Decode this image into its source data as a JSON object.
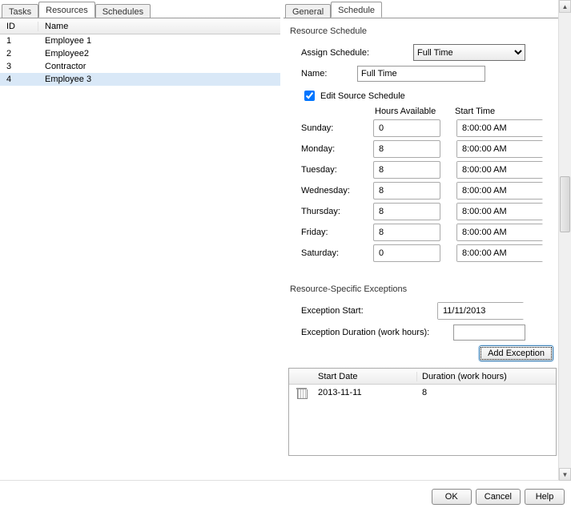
{
  "leftTabs": {
    "items": [
      "Tasks",
      "Resources",
      "Schedules"
    ],
    "active": 1
  },
  "grid": {
    "headers": {
      "id": "ID",
      "name": "Name"
    },
    "rows": [
      {
        "id": "1",
        "name": "Employee 1"
      },
      {
        "id": "2",
        "name": "Employee2"
      },
      {
        "id": "3",
        "name": "Contractor"
      },
      {
        "id": "4",
        "name": "Employee 3"
      }
    ],
    "selected": 3
  },
  "rightTabs": {
    "items": [
      "General",
      "Schedule"
    ],
    "active": 1
  },
  "schedule": {
    "groupLabel": "Resource Schedule",
    "assignLabel": "Assign Schedule:",
    "assignValue": "Full Time",
    "nameLabel": "Name:",
    "nameValue": "Full Time",
    "editSourceLabel": "Edit Source Schedule",
    "editSourceChecked": true,
    "hoursHeader": "Hours Available",
    "startHeader": "Start Time",
    "days": [
      {
        "label": "Sunday:",
        "hours": "0",
        "start": "8:00:00 AM"
      },
      {
        "label": "Monday:",
        "hours": "8",
        "start": "8:00:00 AM"
      },
      {
        "label": "Tuesday:",
        "hours": "8",
        "start": "8:00:00 AM"
      },
      {
        "label": "Wednesday:",
        "hours": "8",
        "start": "8:00:00 AM"
      },
      {
        "label": "Thursday:",
        "hours": "8",
        "start": "8:00:00 AM"
      },
      {
        "label": "Friday:",
        "hours": "8",
        "start": "8:00:00 AM"
      },
      {
        "label": "Saturday:",
        "hours": "0",
        "start": "8:00:00 AM"
      }
    ]
  },
  "exceptions": {
    "groupLabel": "Resource-Specific Exceptions",
    "startLabel": "Exception Start:",
    "startValue": "11/11/2013",
    "durationLabel": "Exception Duration (work hours):",
    "durationValue": "",
    "addButton": "Add Exception",
    "table": {
      "headers": {
        "start": "Start Date",
        "dur": "Duration (work hours)"
      },
      "rows": [
        {
          "start": "2013-11-11",
          "dur": "8"
        }
      ]
    }
  },
  "footer": {
    "ok": "OK",
    "cancel": "Cancel",
    "help": "Help"
  }
}
